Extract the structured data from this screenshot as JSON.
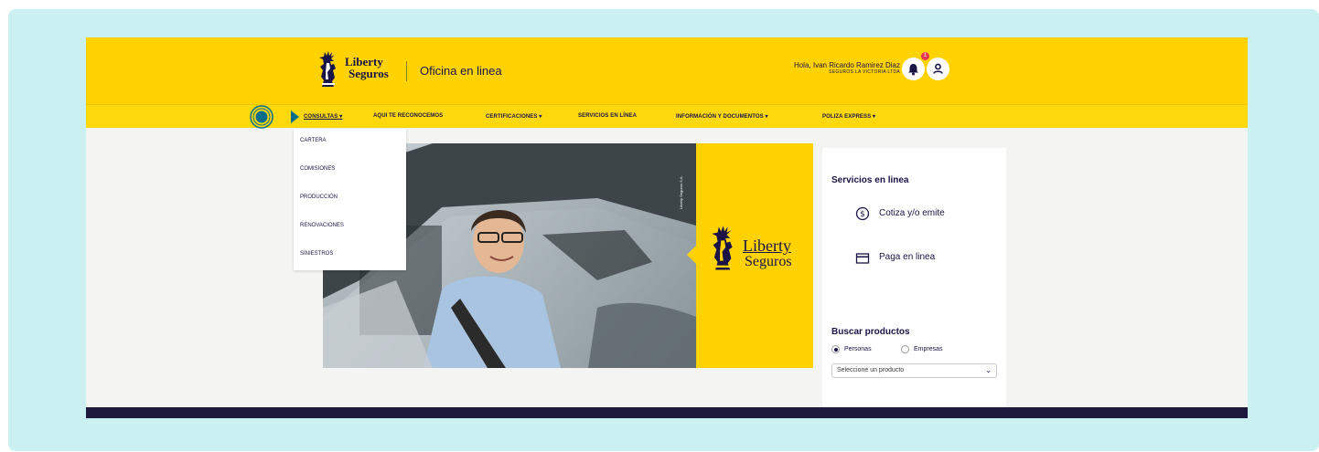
{
  "header": {
    "logo_line1": "Liberty",
    "logo_line2": "Seguros",
    "app_title": "Oficina en linea",
    "greeting_name": "Hola, Ivan Ricardo Ramirez Diaz",
    "greeting_org": "SEGUROS LA VICTORIA LTDA",
    "notification_count": "1"
  },
  "nav": {
    "items": [
      "CONSULTAS",
      "AQUI TE RECONOCEMOS",
      "CERTIFICACIONES",
      "SERVICIOS EN LÍNEA",
      "INFORMACIÓN Y DOCUMENTOS",
      "POLIZA EXPRESS"
    ]
  },
  "dropdown": {
    "items": [
      "CARTERA",
      "COMISIONES",
      "PRODUCCIÓN",
      "RENOVACIONES",
      "SINIESTROS"
    ]
  },
  "hero": {
    "credit": "Liberty Seguros S.A.",
    "logo_line1": "Liberty",
    "logo_line2": "Seguros"
  },
  "side": {
    "services_title": "Servicios en linea",
    "quote_label": "Cotiza y/o emite",
    "pay_label": "Paga en linea",
    "products_title": "Buscar productos",
    "radio_personas": "Personas",
    "radio_empresas": "Empresas",
    "select_placeholder": "Seleccione un producto"
  },
  "colors": {
    "brand_yellow": "#ffd200",
    "brand_navy": "#1a1446",
    "frame_teal": "#caf0f2",
    "marker_teal": "#0a6e8a"
  }
}
